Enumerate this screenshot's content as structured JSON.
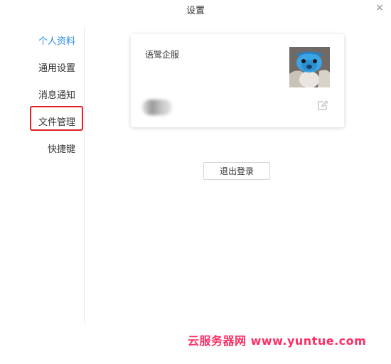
{
  "window": {
    "title": "设置",
    "close_symbol": "×"
  },
  "sidebar": {
    "items": [
      {
        "label": "个人资料",
        "active": true
      },
      {
        "label": "通用设置",
        "active": false
      },
      {
        "label": "消息通知",
        "active": false
      },
      {
        "label": "文件管理",
        "active": false
      },
      {
        "label": "快捷键",
        "active": false
      }
    ]
  },
  "profile": {
    "name": "语鹭企服",
    "avatar": "avatar-photo"
  },
  "actions": {
    "logout_label": "退出登录"
  },
  "watermark": {
    "text": "云服务器网 www.yuntue.com"
  },
  "colors": {
    "accent": "#2b8de8",
    "highlight_border": "#e0202a",
    "watermark": "#ff2e63"
  }
}
